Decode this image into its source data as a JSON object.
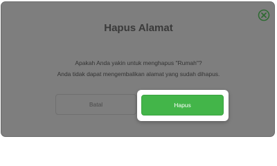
{
  "dialog": {
    "title": "Hapus Alamat",
    "message_line1": "Apakah Anda yakin untuk menghapus \"Rumah\"?",
    "message_line2": "Anda tidak dapat mengembalikan alamat yang sudah dihapus.",
    "close_icon": "close-circle-icon",
    "cancel_label": "Batal",
    "confirm_label": "Hapus"
  },
  "colors": {
    "accent_green": "#43b549",
    "dialog_bg": "#7e7e7e"
  }
}
